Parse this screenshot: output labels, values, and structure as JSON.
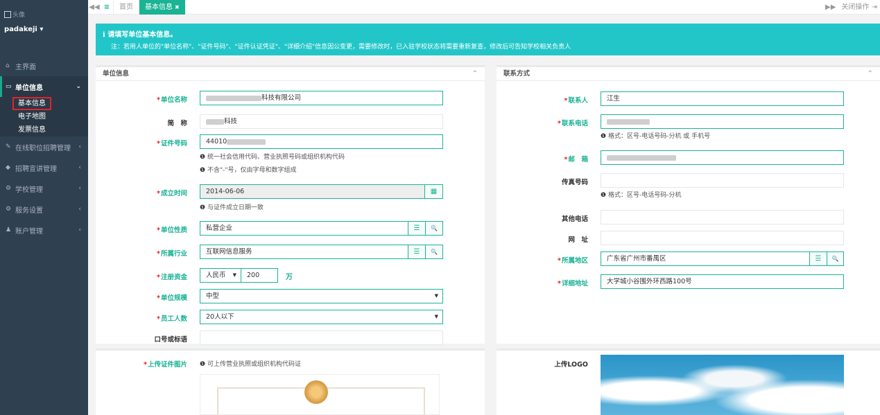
{
  "sidebar": {
    "logo_text": "头像",
    "user": "padakeji",
    "user_caret": "▾",
    "items": [
      {
        "icon": "home-icon",
        "glyph": "⌂",
        "label": "主界面"
      },
      {
        "icon": "monitor-icon",
        "glyph": "▭",
        "label": "单位信息",
        "arrow": "⌄"
      },
      {
        "icon": "megaphone-icon",
        "glyph": "✎",
        "label": "在线职位招聘管理",
        "arrow": "‹"
      },
      {
        "icon": "tag-icon",
        "glyph": "◆",
        "label": "招聘宣讲管理",
        "arrow": "‹"
      },
      {
        "icon": "cogs-icon",
        "glyph": "⚙",
        "label": "学校管理",
        "arrow": "‹"
      },
      {
        "icon": "cogs-icon",
        "glyph": "⚙",
        "label": "服务设置",
        "arrow": "‹"
      },
      {
        "icon": "user-icon",
        "glyph": "♟",
        "label": "账户管理",
        "arrow": "‹"
      }
    ],
    "subitems": [
      "基本信息",
      "电子地图",
      "发票信息"
    ]
  },
  "tabbar": {
    "back": "◀◀",
    "menu": "≡",
    "tabs": [
      "首页",
      "基本信息"
    ],
    "close_tab": "✖",
    "forward": "▶▶",
    "close_ops": "关闭操作",
    "close_ops_icon": "⇥"
  },
  "alert": {
    "title": "请填写单位基本信息。",
    "icon": "ℹ",
    "note": "注：若用人单位的\"单位名称\"、\"证件号码\"、\"证件认证凭证\"、\"详细介绍\"信息因公变更，需要修改时，已入驻学校状态将需要重新复查，修改后可告知学校相关负责人"
  },
  "unit_info": {
    "title": "单位信息",
    "chevron": "⌃",
    "name_label": "单位名称",
    "name_value": "科技有限公司",
    "short_label": "简　称",
    "short_value": "科技",
    "cert_label": "证件号码",
    "cert_value": "44010",
    "cert_hint1": "统一社会信用代码、营业执照号码或组织机构代码",
    "cert_hint2": "不含\"-\"号，仅由字母和数字组成",
    "founded_label": "成立时间",
    "founded_value": "2014-06-06",
    "founded_hint": "与证件成立日期一致",
    "nature_label": "单位性质",
    "nature_value": "私营企业",
    "industry_label": "所属行业",
    "industry_value": "互联网信息服务",
    "capital_label": "注册资金",
    "capital_currency": "人民币",
    "capital_value": "200",
    "capital_unit": "万",
    "scale_label": "单位规模",
    "scale_value": "中型",
    "staff_label": "员工人数",
    "staff_value": "20人以下",
    "slogan_label": "口号或标语",
    "slogan_value": ""
  },
  "contact": {
    "title": "联系方式",
    "chevron": "⌃",
    "contact_label": "联系人",
    "contact_value": "江生",
    "phone_label": "联系电话",
    "phone_hint": "格式：区号-电话号码-分机 或 手机号",
    "email_label": "邮　箱",
    "fax_label": "传真号码",
    "fax_hint": "格式：区号-电话号码-分机",
    "other_phone_label": "其他电话",
    "website_label": "网　址",
    "region_label": "所属地区",
    "region_value": "广东省广州市番禺区",
    "address_label": "详细地址",
    "address_value": "大学城小谷围外环西路100号"
  },
  "uploads": {
    "cert_label": "上传证件图片",
    "cert_hint": "可上传营业执照或组织机构代码证",
    "logo_label": "上传LOGO"
  },
  "icons": {
    "info": "❶",
    "calendar": "▦",
    "list": "☰",
    "search": "🔍"
  },
  "colors": {
    "accent": "#1ab394",
    "sidebar": "#2f4050",
    "alert": "#23c6c8",
    "required": "#e0242b"
  }
}
